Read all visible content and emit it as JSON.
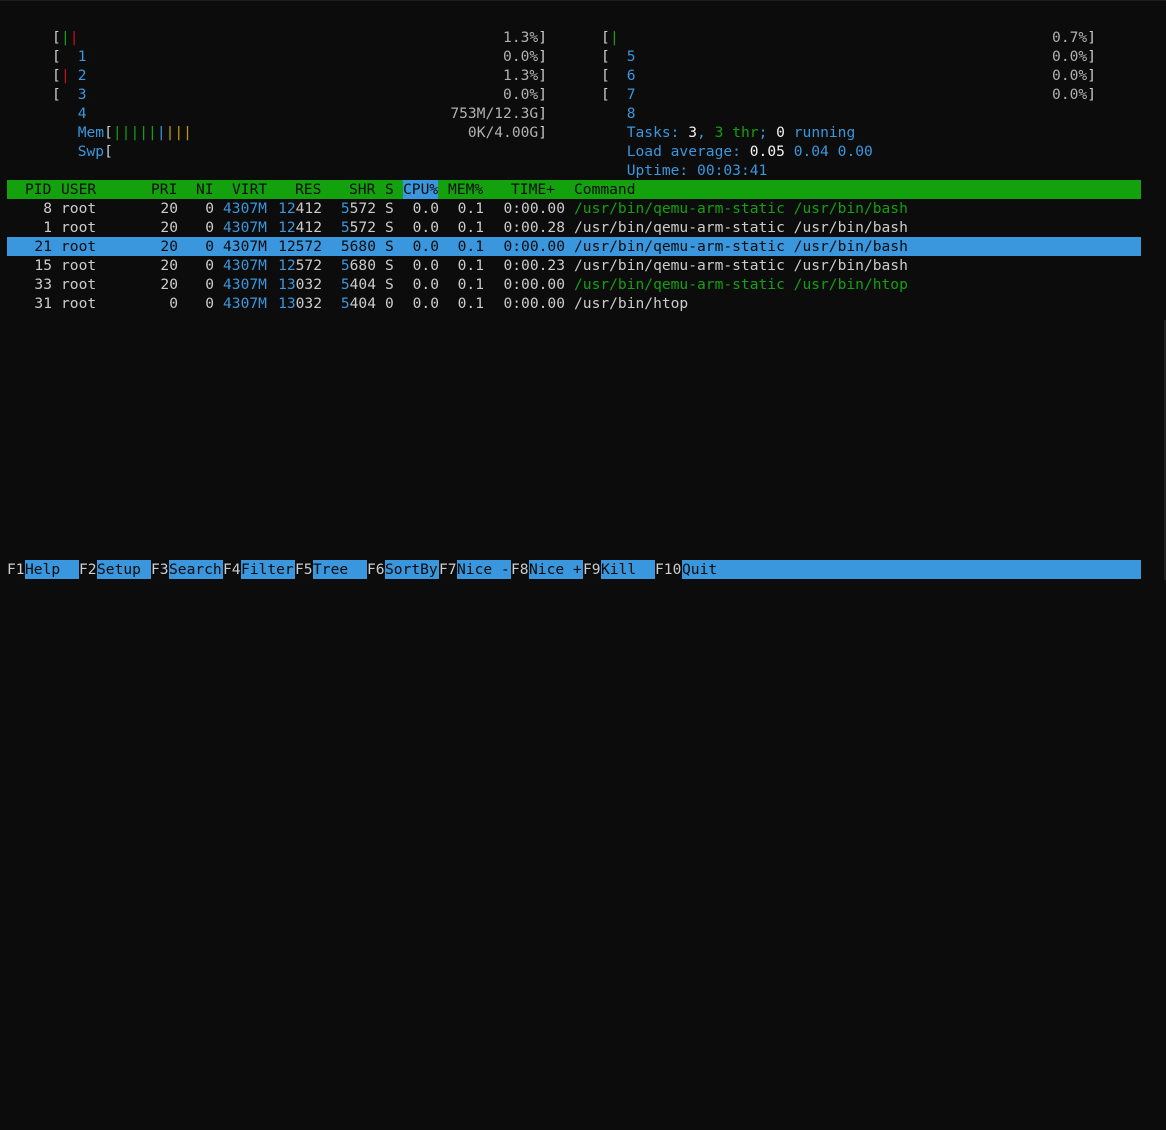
{
  "cpus_left": [
    {
      "id": "1",
      "bars": [
        {
          "c": "green",
          "t": "|"
        },
        {
          "c": "red",
          "t": "|"
        }
      ],
      "pct": "1.3%"
    },
    {
      "id": "2",
      "bars": [],
      "pct": "0.0%"
    },
    {
      "id": "3",
      "bars": [
        {
          "c": "red",
          "t": "|"
        }
      ],
      "pct": "1.3%"
    },
    {
      "id": "4",
      "bars": [],
      "pct": "0.0%"
    }
  ],
  "cpus_right": [
    {
      "id": "5",
      "bars": [
        {
          "c": "green",
          "t": "|"
        }
      ],
      "pct": "0.7%"
    },
    {
      "id": "6",
      "bars": [],
      "pct": "0.0%"
    },
    {
      "id": "7",
      "bars": [],
      "pct": "0.0%"
    },
    {
      "id": "8",
      "bars": [],
      "pct": "0.0%"
    }
  ],
  "mem": {
    "label": "Mem",
    "bars": [
      {
        "c": "green",
        "t": "|||||"
      },
      {
        "c": "blue",
        "t": "|"
      },
      {
        "c": "yellow",
        "t": "|||"
      }
    ],
    "value": "753M/12.3G"
  },
  "swp": {
    "label": "Swp",
    "value": "0K/4.00G"
  },
  "tasks": {
    "label": "Tasks:",
    "count": "3",
    "sep": ",",
    "thr": "3 thr",
    "semi": ";",
    "running": "0",
    "running_label": "running"
  },
  "load": {
    "label": "Load average:",
    "v1": "0.05",
    "v2": "0.04",
    "v3": "0.00"
  },
  "uptime": {
    "label": "Uptime:",
    "value": "00:03:41"
  },
  "columns": {
    "pid": "PID",
    "user": "USER",
    "pri": "PRI",
    "ni": "NI",
    "virt": "VIRT",
    "res": "RES",
    "shr": "SHR",
    "s": "S",
    "cpu": "CPU%",
    "mem": "MEM%",
    "time": "TIME+",
    "command": "Command"
  },
  "processes": [
    {
      "pid": "8",
      "user": "root",
      "pri": "20",
      "ni": "0",
      "virt": "4307M",
      "res_a": "12",
      "res_b": "412",
      "shr_a": "5",
      "shr_b": "572",
      "s": "S",
      "cpu": "0.0",
      "mem": "0.1",
      "time": "0:00.00",
      "command": "/usr/bin/qemu-arm-static /usr/bin/bash",
      "cmd_green": true,
      "selected": false
    },
    {
      "pid": "1",
      "user": "root",
      "pri": "20",
      "ni": "0",
      "virt": "4307M",
      "res_a": "12",
      "res_b": "412",
      "shr_a": "5",
      "shr_b": "572",
      "s": "S",
      "cpu": "0.0",
      "mem": "0.1",
      "time": "0:00.28",
      "command": "/usr/bin/qemu-arm-static /usr/bin/bash",
      "cmd_green": false,
      "selected": false
    },
    {
      "pid": "21",
      "user": "root",
      "pri": "20",
      "ni": "0",
      "virt": "4307M",
      "res_a": "12",
      "res_b": "572",
      "shr_a": "5",
      "shr_b": "680",
      "s": "S",
      "cpu": "0.0",
      "mem": "0.1",
      "time": "0:00.00",
      "command": "/usr/bin/qemu-arm-static /usr/bin/bash",
      "cmd_green": false,
      "selected": true
    },
    {
      "pid": "15",
      "user": "root",
      "pri": "20",
      "ni": "0",
      "virt": "4307M",
      "res_a": "12",
      "res_b": "572",
      "shr_a": "5",
      "shr_b": "680",
      "s": "S",
      "cpu": "0.0",
      "mem": "0.1",
      "time": "0:00.23",
      "command": "/usr/bin/qemu-arm-static /usr/bin/bash",
      "cmd_green": false,
      "selected": false
    },
    {
      "pid": "33",
      "user": "root",
      "pri": "20",
      "ni": "0",
      "virt": "4307M",
      "res_a": "13",
      "res_b": "032",
      "shr_a": "5",
      "shr_b": "404",
      "s": "S",
      "cpu": "0.0",
      "mem": "0.1",
      "time": "0:00.00",
      "command": "/usr/bin/qemu-arm-static /usr/bin/htop",
      "cmd_green": true,
      "selected": false
    },
    {
      "pid": "31",
      "user": "root",
      "pri": "0",
      "ni": "0",
      "virt": "4307M",
      "res_a": "13",
      "res_b": "032",
      "shr_a": "5",
      "shr_b": "404",
      "s": "0",
      "cpu": "0.0",
      "mem": "0.1",
      "time": "0:00.00",
      "command": "/usr/bin/htop",
      "cmd_green": false,
      "selected": false
    }
  ],
  "fkeys": [
    {
      "key": "F1",
      "label": "Help"
    },
    {
      "key": "F2",
      "label": "Setup"
    },
    {
      "key": "F3",
      "label": "Search"
    },
    {
      "key": "F4",
      "label": "Filter"
    },
    {
      "key": "F5",
      "label": "Tree"
    },
    {
      "key": "F6",
      "label": "SortBy"
    },
    {
      "key": "F7",
      "label": "Nice -"
    },
    {
      "key": "F8",
      "label": "Nice +"
    },
    {
      "key": "F9",
      "label": "Kill"
    },
    {
      "key": "F10",
      "label": "Quit"
    }
  ],
  "colors": {
    "background": "#0c0c0c",
    "header_green": "#13a10e",
    "accent_blue": "#3a96dd",
    "red": "#c50f1f",
    "yellow": "#c19c00"
  }
}
